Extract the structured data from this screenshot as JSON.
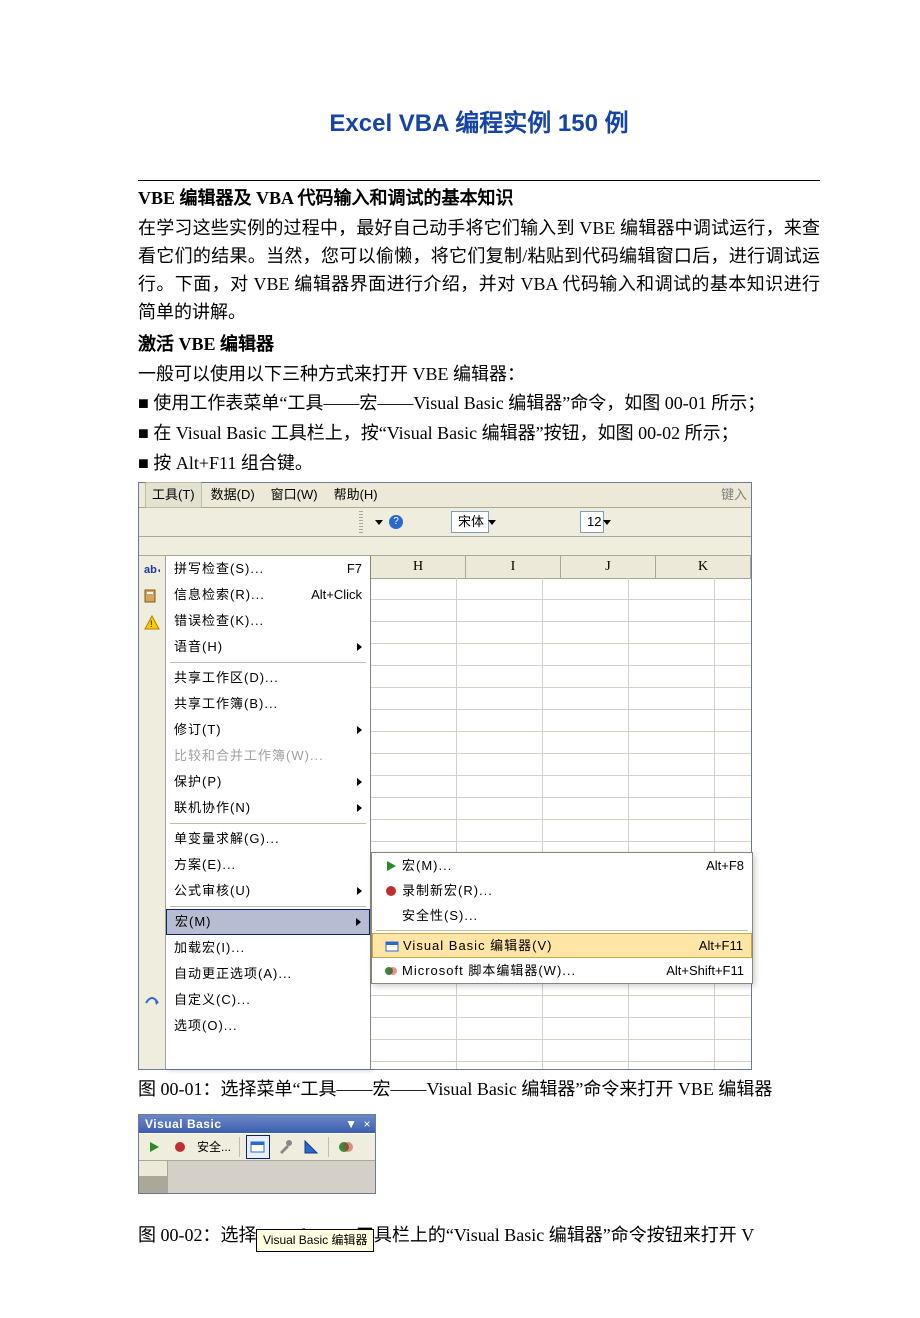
{
  "title": "Excel VBA 编程实例 150 例",
  "h1": "VBE 编辑器及 VBA 代码输入和调试的基本知识",
  "para1": "在学习这些实例的过程中，最好自己动手将它们输入到 VBE 编辑器中调试运行，来查看它们的结果。当然，您可以偷懒，将它们复制/粘贴到代码编辑窗口后，进行调试运行。下面，对 VBE 编辑器界面进行介绍，并对 VBA 代码输入和调试的基本知识进行简单的讲解。",
  "h2": "激活 VBE 编辑器",
  "para2": "一般可以使用以下三种方式来打开 VBE 编辑器：",
  "bullets": [
    "■ 使用工作表菜单“工具——宏——Visual Basic 编辑器”命令，如图 00-01 所示；",
    "■ 在 Visual Basic 工具栏上，按“Visual Basic 编辑器”按钮，如图 00-02 所示；",
    "■ 按 Alt+F11 组合键。"
  ],
  "fig1": {
    "menubar": {
      "tools": "工具(T)",
      "data": "数据(D)",
      "window": "窗口(W)",
      "help": "帮助(H)",
      "hint": "键入"
    },
    "toolbar": {
      "font_name": "宋体",
      "font_size": "12"
    },
    "col_headers": [
      "H",
      "I",
      "J",
      "K"
    ],
    "tools_menu": [
      {
        "label": "拼写检查(S)...",
        "accel": "F7",
        "icon": "spellcheck"
      },
      {
        "label": "信息检索(R)...",
        "accel": "Alt+Click",
        "icon": "research"
      },
      {
        "label": "错误检查(K)...",
        "icon": "errorcheck"
      },
      {
        "label": "语音(H)",
        "arrow": true
      },
      {
        "sep": true
      },
      {
        "label": "共享工作区(D)..."
      },
      {
        "label": "共享工作簿(B)..."
      },
      {
        "label": "修订(T)",
        "arrow": true
      },
      {
        "label": "比较和合并工作簿(W)...",
        "disabled": true
      },
      {
        "label": "保护(P)",
        "arrow": true
      },
      {
        "label": "联机协作(N)",
        "arrow": true
      },
      {
        "sep": true
      },
      {
        "label": "单变量求解(G)..."
      },
      {
        "label": "方案(E)..."
      },
      {
        "label": "公式审核(U)",
        "arrow": true
      },
      {
        "sep": true
      },
      {
        "label": "宏(M)",
        "arrow": true,
        "hi": true
      },
      {
        "label": "加载宏(I)..."
      },
      {
        "label": "自动更正选项(A)...",
        "icon": "autocorrect"
      },
      {
        "label": "自定义(C)..."
      },
      {
        "label": "选项(O)..."
      }
    ],
    "submenu": [
      {
        "label": "宏(M)...",
        "accel": "Alt+F8",
        "icon": "play"
      },
      {
        "label": "录制新宏(R)...",
        "icon": "record"
      },
      {
        "label": "安全性(S)..."
      },
      {
        "sep": true
      },
      {
        "label": "Visual Basic 编辑器(V)",
        "accel": "Alt+F11",
        "icon": "vbe",
        "hi": true
      },
      {
        "label": "Microsoft 脚本编辑器(W)...",
        "accel": "Alt+Shift+F11",
        "icon": "script"
      }
    ]
  },
  "caption1": "图 00-01：选择菜单“工具——宏——Visual Basic 编辑器”命令来打开 VBE 编辑器",
  "fig2": {
    "title": "Visual Basic",
    "safety_btn": "安全...",
    "tooltip": "Visual Basic 编辑器"
  },
  "caption2": "图 00-02：选择 Visual Basic 工具栏上的“Visual Basic 编辑器”命令按钮来打开 V"
}
